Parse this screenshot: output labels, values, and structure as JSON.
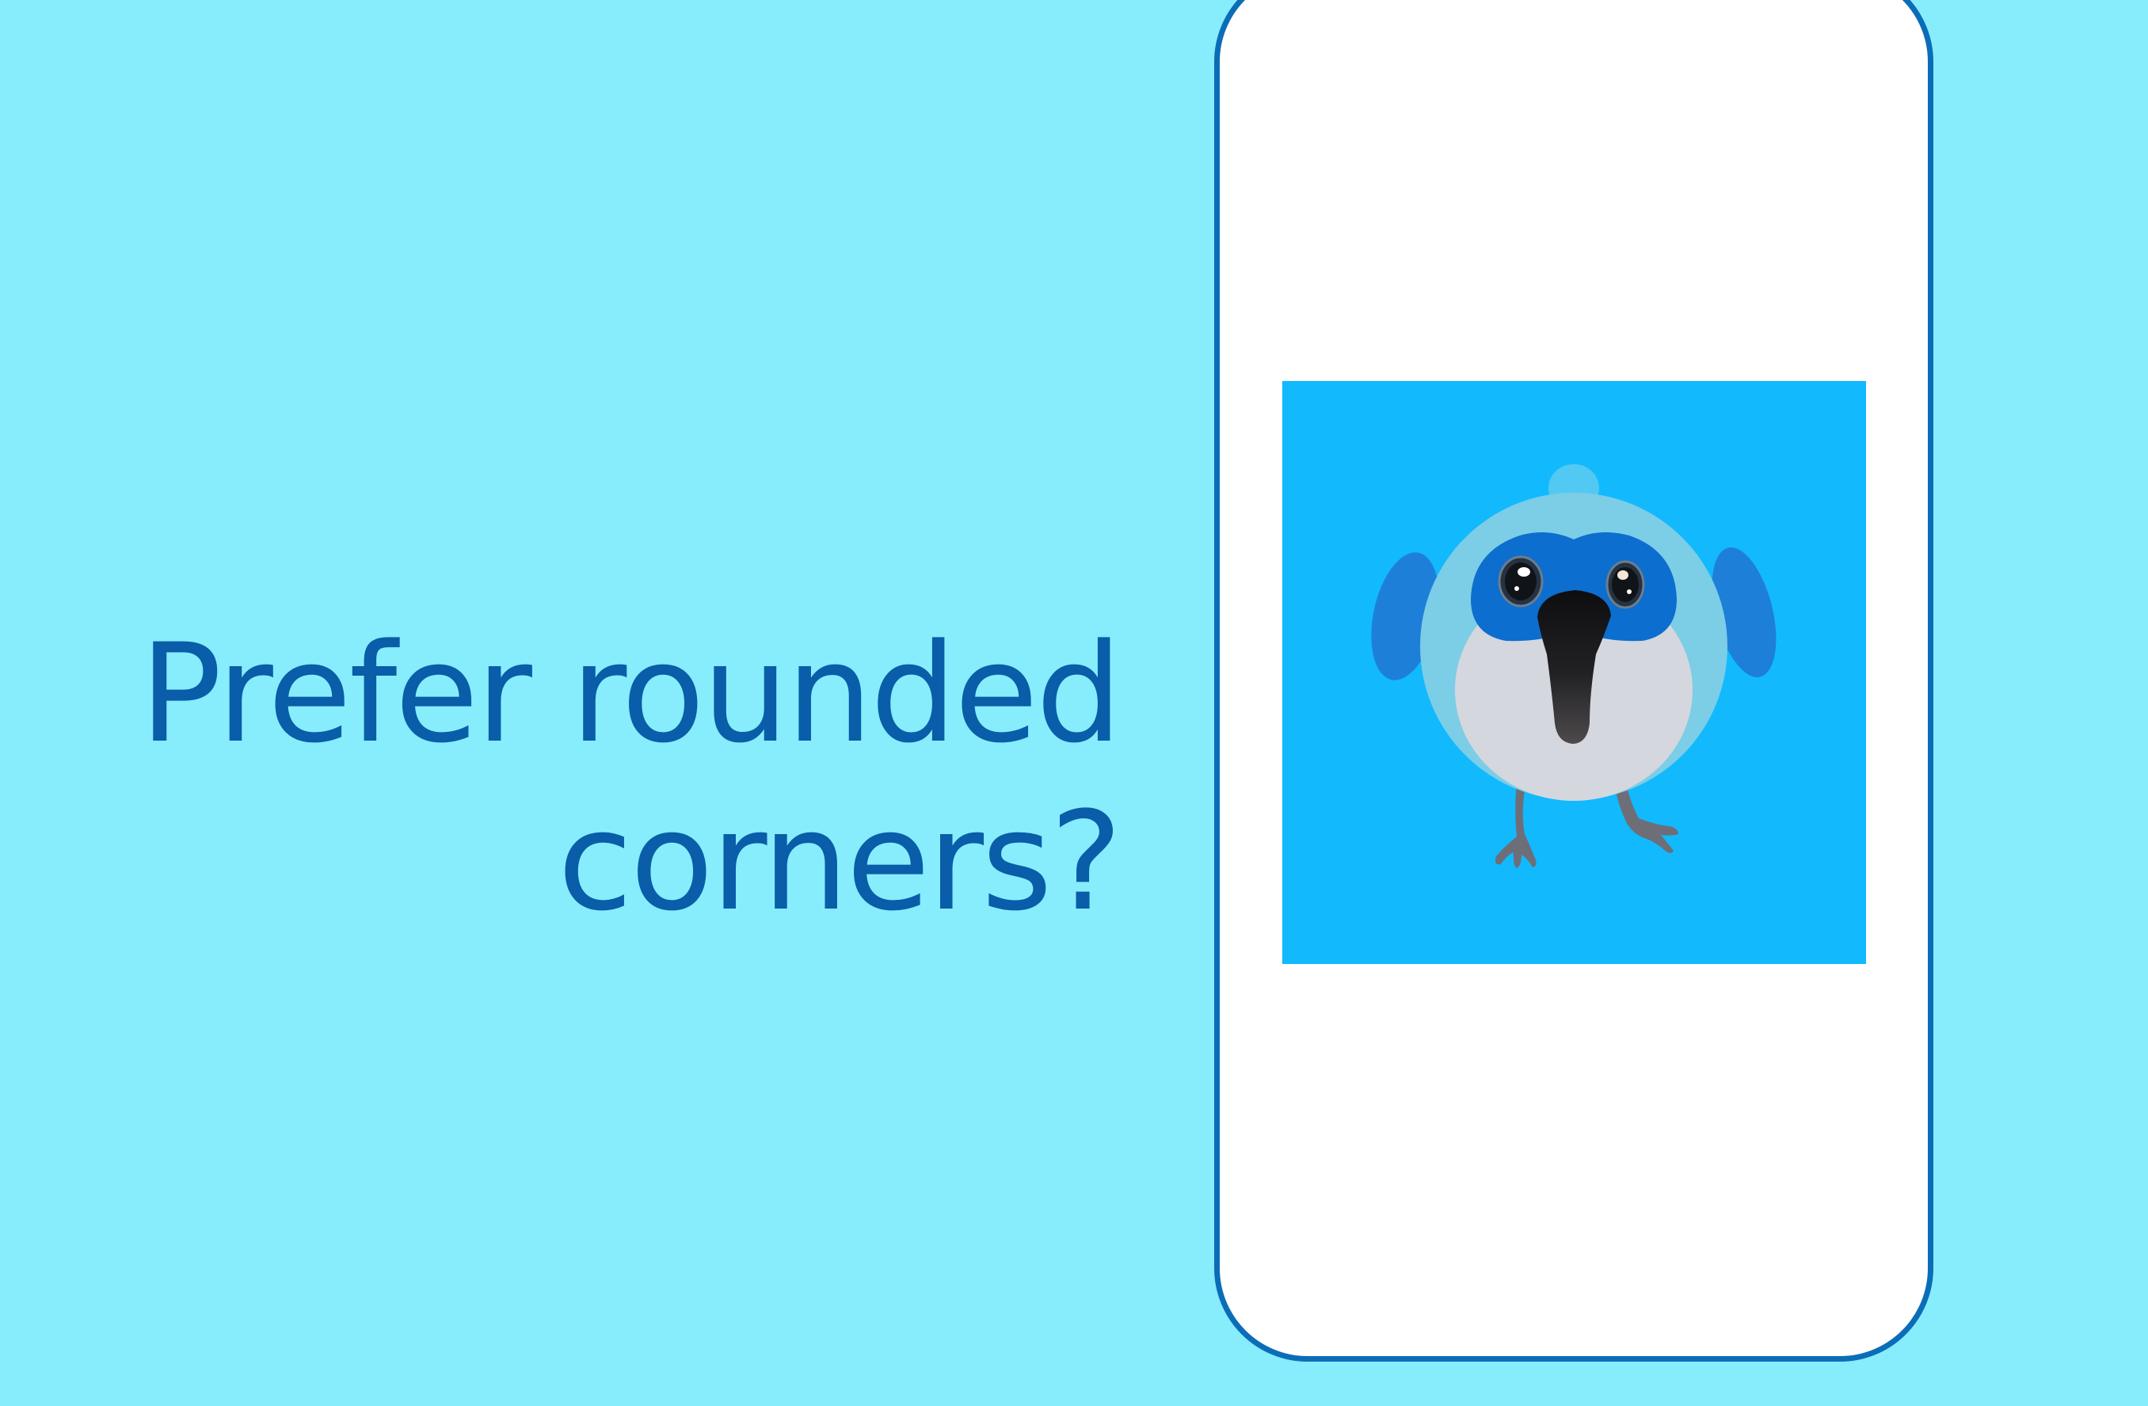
{
  "headline": {
    "line1": "Prefer rounded",
    "line2": "corners?"
  },
  "colors": {
    "background": "#87EDFC",
    "headline_text": "#0A5DA8",
    "phone_outline": "#0B6DB8",
    "phone_screen": "#FFFFFF",
    "image_background": "#12B9FD"
  },
  "phone": {
    "image": {
      "subject": "blue bird mascot illustration",
      "icon": "bird-illustration"
    }
  }
}
